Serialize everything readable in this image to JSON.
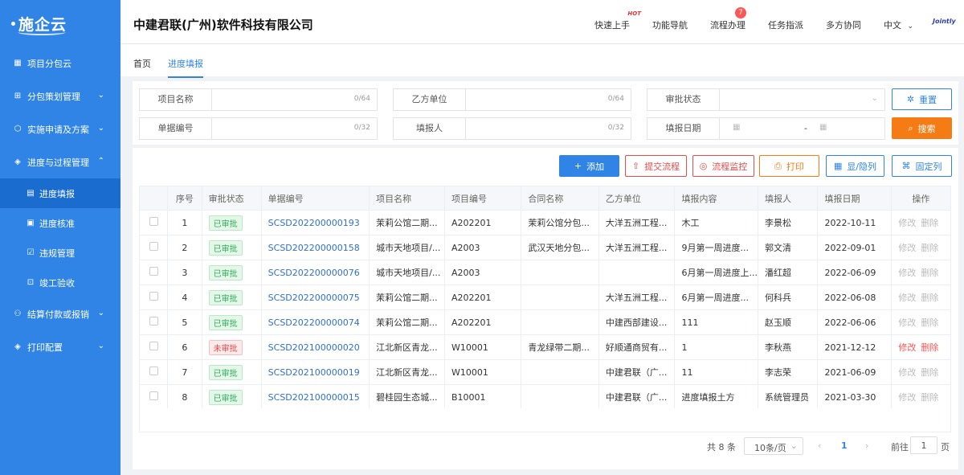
{
  "sidebar": {
    "logo": "施企云",
    "items": [
      {
        "label": "项目分包云",
        "icon": "grid-icon",
        "chev": ""
      },
      {
        "label": "分包策划管理",
        "icon": "apps-icon",
        "chev": "⌄"
      },
      {
        "label": "实施申请及方案",
        "icon": "cube-icon",
        "chev": "⌄"
      },
      {
        "label": "进度与过程管理",
        "icon": "layers-icon",
        "chev": "⌃"
      }
    ],
    "sub_items": [
      {
        "label": "进度填报",
        "icon": "report-icon"
      },
      {
        "label": "进度核准",
        "icon": "file-check-icon"
      },
      {
        "label": "违规管理",
        "icon": "clipboard-check-icon"
      },
      {
        "label": "竣工验收",
        "icon": "acceptance-icon"
      }
    ],
    "bottom_items": [
      {
        "label": "结算付款或报销",
        "icon": "org-icon",
        "chev": "⌄"
      },
      {
        "label": "打印配置",
        "icon": "layers-icon",
        "chev": "⌄"
      }
    ]
  },
  "header": {
    "company": "中建君联(广州)软件科技有限公司",
    "nav": [
      "快速上手",
      "功能导航",
      "流程办理",
      "任务指派",
      "多方协同",
      "中文"
    ],
    "hot": "HOT",
    "badge": "7",
    "brand": "Jointly"
  },
  "breadcrumbs": [
    "首页",
    "进度填报"
  ],
  "filters": {
    "project_name": {
      "label": "项目名称",
      "count": "0/64"
    },
    "party_b": {
      "label": "乙方单位",
      "count": "0/64"
    },
    "approval_status": {
      "label": "审批状态"
    },
    "doc_no": {
      "label": "单据编号",
      "count": "0/32"
    },
    "reporter": {
      "label": "填报人",
      "count": "0/32"
    },
    "report_date": {
      "label": "填报日期",
      "sep": "-"
    },
    "reset": "重置",
    "search": "搜索"
  },
  "toolbar": {
    "add": "添加",
    "submit": "提交流程",
    "monitor": "流程监控",
    "print": "打印",
    "columns": "显/隐列",
    "pin": "固定列"
  },
  "table": {
    "headers": [
      "序号",
      "审批状态",
      "单据编号",
      "项目名称",
      "项目编号",
      "合同名称",
      "乙方单位",
      "填报内容",
      "填报人",
      "填报日期",
      "操作"
    ],
    "rows": [
      {
        "no": "1",
        "status": "已审批",
        "ok": true,
        "doc": "SCSD202200000193",
        "project": "茉莉公馆二期...",
        "code": "A202201",
        "contract": "茉莉公馆分包...",
        "partyb": "大洋五洲工程...",
        "content": "木工",
        "reporter": "李景松",
        "date": "2022-10-11",
        "edit": "修改",
        "del": "删除"
      },
      {
        "no": "2",
        "status": "已审批",
        "ok": true,
        "doc": "SCSD202200000158",
        "project": "城市天地项目/...",
        "code": "A2003",
        "contract": "武汉天地分包...",
        "partyb": "大洋五洲工程...",
        "content": "9月第一周进度...",
        "reporter": "郭文清",
        "date": "2022-09-01",
        "edit": "修改",
        "del": "删除"
      },
      {
        "no": "3",
        "status": "已审批",
        "ok": true,
        "doc": "SCSD202200000076",
        "project": "城市天地项目/...",
        "code": "A2003",
        "contract": "",
        "partyb": "",
        "content": "6月第一周进度上...",
        "reporter": "潘红超",
        "date": "2022-06-09",
        "edit": "修改",
        "del": "删除"
      },
      {
        "no": "4",
        "status": "已审批",
        "ok": true,
        "doc": "SCSD202200000075",
        "project": "茉莉公馆二期...",
        "code": "A202201",
        "contract": "",
        "partyb": "大洋五洲工程...",
        "content": "6月第一周进度...",
        "reporter": "何科兵",
        "date": "2022-06-08",
        "edit": "修改",
        "del": "删除"
      },
      {
        "no": "5",
        "status": "已审批",
        "ok": true,
        "doc": "SCSD202200000074",
        "project": "茉莉公馆二期...",
        "code": "A202201",
        "contract": "",
        "partyb": "中建西部建设...",
        "content": "111",
        "reporter": "赵玉顺",
        "date": "2022-06-06",
        "edit": "修改",
        "del": "删除"
      },
      {
        "no": "6",
        "status": "未审批",
        "ok": false,
        "doc": "SCSD202100000020",
        "project": "江北新区青龙...",
        "code": "W10001",
        "contract": "青龙绿带二期...",
        "partyb": "好顺通商贸有...",
        "content": "1",
        "reporter": "李秋燕",
        "date": "2021-12-12",
        "edit": "修改",
        "del": "删除"
      },
      {
        "no": "7",
        "status": "已审批",
        "ok": true,
        "doc": "SCSD202100000019",
        "project": "江北新区青龙...",
        "code": "W10001",
        "contract": "",
        "partyb": "中建君联（广...",
        "content": "11",
        "reporter": "李志荣",
        "date": "2021-06-09",
        "edit": "修改",
        "del": "删除"
      },
      {
        "no": "8",
        "status": "已审批",
        "ok": true,
        "doc": "SCSD202100000015",
        "project": "碧桂园生态城...",
        "code": "B10001",
        "contract": "",
        "partyb": "中建君联（广...",
        "content": "进度填报土方",
        "reporter": "系统管理员",
        "date": "2021-03-30",
        "edit": "修改",
        "del": "删除"
      }
    ]
  },
  "pagination": {
    "total": "共 8 条",
    "page_size": "10条/页",
    "current": "1",
    "goto_label": "前往",
    "goto_value": "1",
    "page_unit": "页"
  },
  "colors": {
    "primary": "#2f84e6",
    "search": "#f57c14",
    "danger": "#e84b4b"
  }
}
